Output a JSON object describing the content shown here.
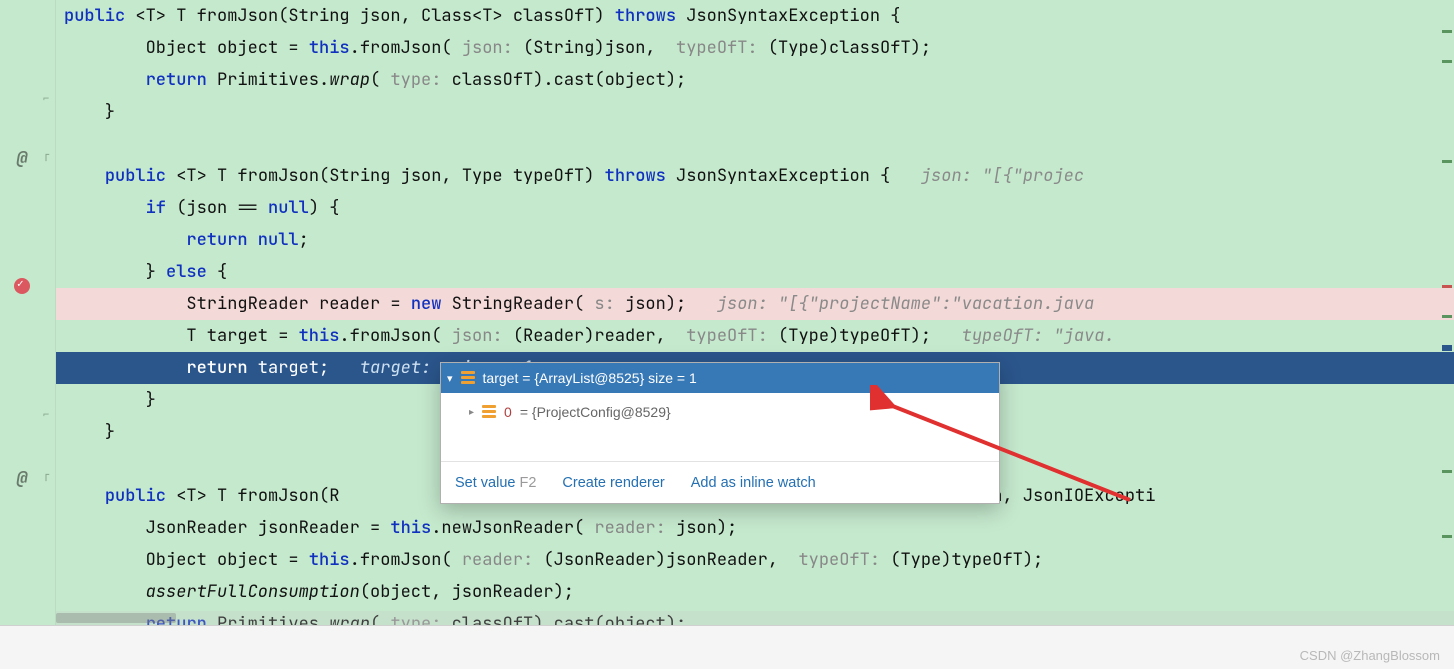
{
  "gutter": {
    "breakpoint_tooltip": "Breakpoint (verified)"
  },
  "lines": {
    "l0": "    public <T> T fromJson(String json, Class<T> classOfT) throws JsonSyntaxException {",
    "l1_a": "        Object object = ",
    "l1_b": "this",
    "l1_c": ".fromJson( ",
    "l1_hint1": "json:",
    "l1_d": " (String)json,  ",
    "l1_hint2": "typeOfT:",
    "l1_e": " (Type)classOfT);",
    "l2_a": "        ",
    "l2_kw": "return",
    "l2_b": " Primitives.",
    "l2_c": "wrap",
    "l2_d": "( ",
    "l2_hint": "type:",
    "l2_e": " classOfT).cast(object);",
    "l3": "    }",
    "l4": "",
    "l5_a": "    ",
    "l5_kw1": "public",
    "l5_b": " <T> T ",
    "l5_name": "fromJson",
    "l5_c": "(String json, Type typeOfT) ",
    "l5_kw2": "throws",
    "l5_d": " JsonSyntaxException {   ",
    "l5_dbg": "json: \"[{\"projec",
    "l6_a": "        ",
    "l6_kw1": "if",
    "l6_b": " (json == ",
    "l6_kw2": "null",
    "l6_c": ") {",
    "l7_a": "            ",
    "l7_kw": "return null",
    "l7_b": ";",
    "l8_a": "        } ",
    "l8_kw": "else",
    "l8_b": " {",
    "l9_a": "            StringReader reader = ",
    "l9_kw": "new",
    "l9_b": " StringReader( ",
    "l9_hint": "s:",
    "l9_c": " json);   ",
    "l9_dbg": "json: \"[{\"projectName\":\"vacation.java",
    "l10_a": "            T target = ",
    "l10_b": "this",
    "l10_c": ".fromJson( ",
    "l10_hint1": "json:",
    "l10_d": " (Reader)reader,  ",
    "l10_hint2": "typeOfT:",
    "l10_e": " (Type)typeOfT);   ",
    "l10_dbg": "typeOfT: \"java.",
    "l11_a": "            ",
    "l11_kw": "return",
    "l11_b": " target;   ",
    "l11_dbg": "target:  size = 1",
    "l12": "        }",
    "l13": "    }",
    "l14": "",
    "l15_a": "    ",
    "l15_kw1": "public",
    "l15_b": " <T> T ",
    "l15_name": "fromJson",
    "l15_c": "(R",
    "l15_d": "onSyntaxException, JsonIOExcepti",
    "l16_a": "        JsonReader jsonReader = ",
    "l16_b": "this",
    "l16_c": ".newJsonReader( ",
    "l16_hint": "reader:",
    "l16_d": " json);",
    "l17_a": "        Object object = ",
    "l17_b": "this",
    "l17_c": ".fromJson( ",
    "l17_hint1": "reader:",
    "l17_d": " (JsonReader)jsonReader,  ",
    "l17_hint2": "typeOfT:",
    "l17_e": " (Type)typeOfT);",
    "l18_a": "        ",
    "l18_m": "assertFullConsumption",
    "l18_b": "(object, jsonReader);",
    "l19_a": "        ",
    "l19_kw": "return",
    "l19_b": " Primitives.",
    "l19_c": "wrap",
    "l19_d": "( ",
    "l19_hint": "type:",
    "l19_e": " classOfT).cast(object);"
  },
  "popup": {
    "header_var": "target",
    "header_eq": " = ",
    "header_val": "{ArrayList@8525}  size = 1",
    "row0_idx": "0",
    "row0_eq": " = ",
    "row0_val": "{ProjectConfig@8529}",
    "footer_setvalue": "Set value",
    "footer_shortcut": "F2",
    "footer_create": "Create renderer",
    "footer_watch": "Add as inline watch"
  },
  "watermark": "CSDN @ZhangBlossom"
}
